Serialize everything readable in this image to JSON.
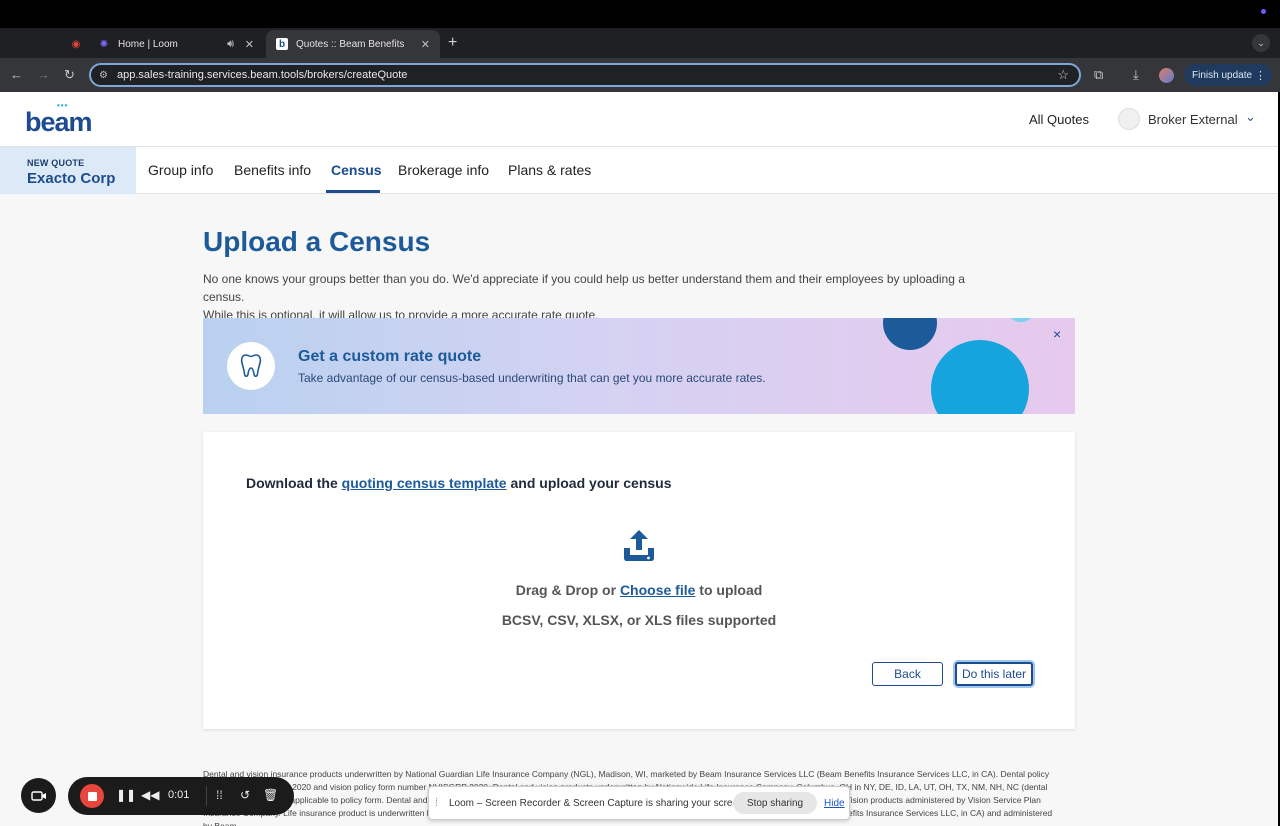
{
  "browser": {
    "tabs": [
      {
        "title": "Home | Loom",
        "icon": "loom-icon",
        "muted_icon": "speaker-icon"
      },
      {
        "title": "Quotes :: Beam Benefits",
        "icon": "beam-favicon"
      }
    ],
    "new_tab": "+",
    "url": "app.sales-training.services.beam.tools/brokers/createQuote",
    "finish_update": "Finish update"
  },
  "header": {
    "logo": "beam",
    "all_quotes": "All Quotes",
    "user": "Broker External"
  },
  "subnav": {
    "quote_label": "NEW QUOTE",
    "company": "Exacto Corp",
    "tabs": [
      "Group info",
      "Benefits info",
      "Census",
      "Brokerage info",
      "Plans & rates"
    ],
    "active_tab": "Census"
  },
  "main": {
    "title": "Upload a Census",
    "intro_1": "No one knows your groups better than you do. We'd appreciate if you could help us better understand them and their employees by uploading a census.",
    "intro_2": "While this is optional, it will allow us to provide a more accurate rate quote."
  },
  "banner": {
    "title": "Get a custom rate quote",
    "text": "Take advantage of our census-based underwriting that can get you more accurate rates.",
    "close": "×"
  },
  "upload": {
    "download_prefix": "Download the ",
    "download_link": "quoting census template",
    "download_suffix": " and upload your census",
    "drag_prefix": "Drag & Drop or ",
    "choose_file": "Choose file",
    "drag_suffix": " to upload",
    "file_types": "BCSV, CSV, XLSX, or XLS files supported",
    "back": "Back",
    "later": "Do this later"
  },
  "legal": {
    "text": "Dental and vision insurance products underwritten by National Guardian Life Insurance Company (NGL), Madison, WI, marketed by Beam Insurance Services LLC (Beam Benefits Insurance Services LLC, in CA). Dental policy form number NDPGRP 2020 and vision policy form number NVISGRP 2020. Dental and vision products underwritten by Nationwide Life Insurance Company, Columbus, OH in NY, DE, ID, LA, UT, OH, TX, NM, NH, NC (dental only). Dental coverage applicable to policy form. Dental and vision products administered by Beam Insurance Administrators LLC (Beam Dental Insurance Administrators). Vision products administered by Vision Service Plan Insurance Company. Life insurance product is underwritten by Nationwide Life Insurance Company, Columbus, OH, marketed by Beam Insurance Services LLC (Beam Benefits Insurance Services LLC, in CA) and administered by Beam."
  },
  "loom": {
    "time": "0:01",
    "share_message": "Loom – Screen Recorder & Screen Capture is sharing your screen.",
    "stop_sharing": "Stop sharing",
    "hide": "Hide"
  }
}
